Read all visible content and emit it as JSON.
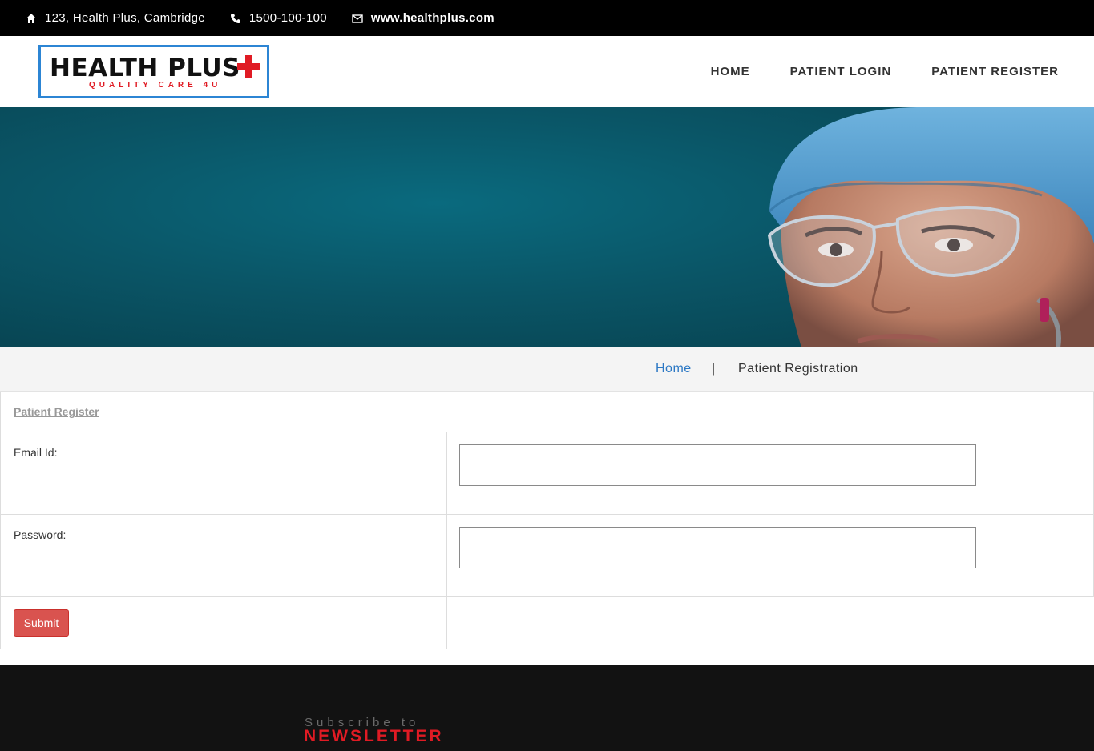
{
  "topbar": {
    "address": "123, Health Plus, Cambridge",
    "phone": "1500-100-100",
    "website": "www.healthplus.com"
  },
  "logo": {
    "name": "HEALTH PLUS",
    "tagline": "QUALITY CARE 4U"
  },
  "nav": {
    "items": [
      "HOME",
      "PATIENT LOGIN",
      "PATIENT REGISTER"
    ]
  },
  "breadcrumb": {
    "home": "Home",
    "separator": "|",
    "current": "Patient Registration"
  },
  "form": {
    "title": "Patient Register",
    "email_label": "Email Id:",
    "email_value": "",
    "password_label": "Password:",
    "password_value": "",
    "submit_label": "Submit"
  },
  "footer": {
    "subscribe": "Subscribe to",
    "newsletter": "NEWSLETTER"
  },
  "colors": {
    "accent_red": "#e01b24",
    "link_blue": "#2c78c4",
    "logo_border": "#2c85d4",
    "button": "#d9534f"
  }
}
